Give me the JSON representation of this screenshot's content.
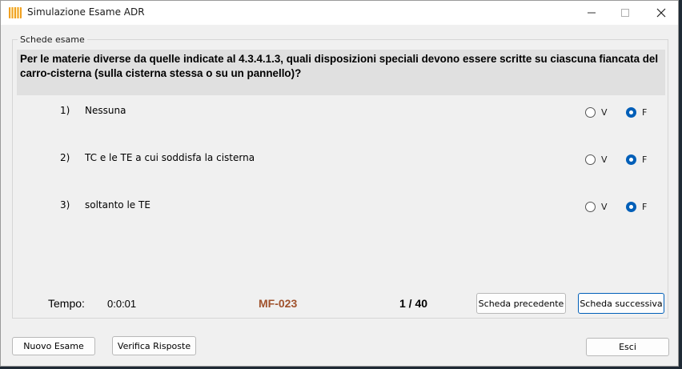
{
  "window": {
    "title": "Simulazione Esame ADR",
    "icon": "adr-app-icon"
  },
  "group": {
    "label": "Schede esame"
  },
  "question": {
    "text": "Per le materie diverse da quelle indicate al 4.3.4.1.3, quali disposizioni speciali devono essere scritte su ciascuna fiancata del carro-cisterna (sulla cisterna stessa o su un pannello)?"
  },
  "answers": [
    {
      "num": "1)",
      "text": "Nessuna",
      "v_label": "V",
      "f_label": "F",
      "selected": "F"
    },
    {
      "num": "2)",
      "text": "TC e le TE a cui soddisfa la cisterna",
      "v_label": "V",
      "f_label": "F",
      "selected": "F"
    },
    {
      "num": "3)",
      "text": "soltanto le TE",
      "v_label": "V",
      "f_label": "F",
      "selected": "F"
    }
  ],
  "status": {
    "time_label": "Tempo:",
    "time_value": "0:0:01",
    "code": "MF-023",
    "counter": "1 / 40",
    "code_color": "#a0522d"
  },
  "nav": {
    "prev_label": "Scheda precedente",
    "next_label": "Scheda successiva"
  },
  "footer": {
    "new_exam_label": "Nuovo Esame",
    "verify_label": "Verifica Risposte",
    "exit_label": "Esci"
  },
  "colors": {
    "accent": "#005fb8",
    "question_bg": "#e0e0e0",
    "window_bg": "#f0f0f0"
  }
}
